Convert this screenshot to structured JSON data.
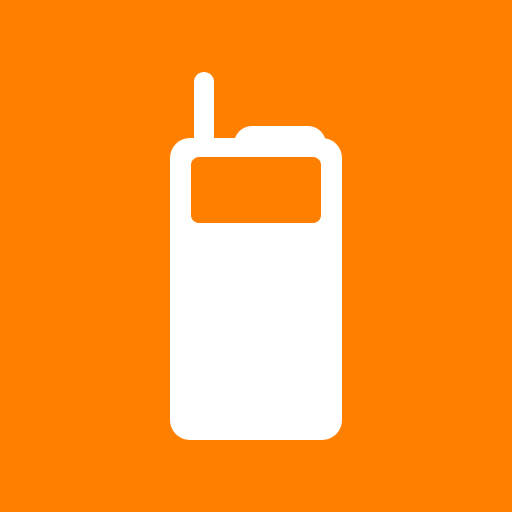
{
  "icon": {
    "name": "walkie-talkie-icon",
    "background_color": "#FF7F00",
    "foreground_color": "#FFFFFF"
  }
}
